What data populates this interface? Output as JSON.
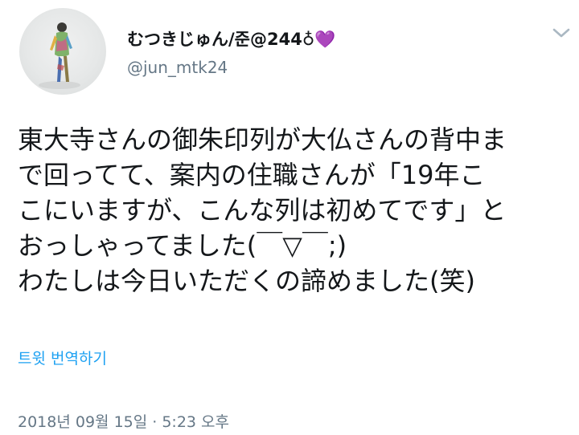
{
  "author": {
    "display_name": "むつきじゅん/준@244♁💜",
    "handle": "@jun_mtk24"
  },
  "tweet": {
    "lines": [
      "東大寺さんの御朱印列が大仏さんの背中ま",
      "で回ってて、案内の住職さんが「19年こ",
      "こにいますが、こんな列は初めてです」と",
      "おっしゃってました(￣▽￣;)",
      "わたしは今日いただくの諦めました(笑)"
    ]
  },
  "translate_label": "트윗 번역하기",
  "timestamp": "2018년 09월 15일 · 5:23 오후",
  "colors": {
    "link": "#1da1f2",
    "secondary_text": "#657786",
    "primary_text": "#14171a"
  },
  "icons": {
    "menu": "chevron-down-icon"
  }
}
